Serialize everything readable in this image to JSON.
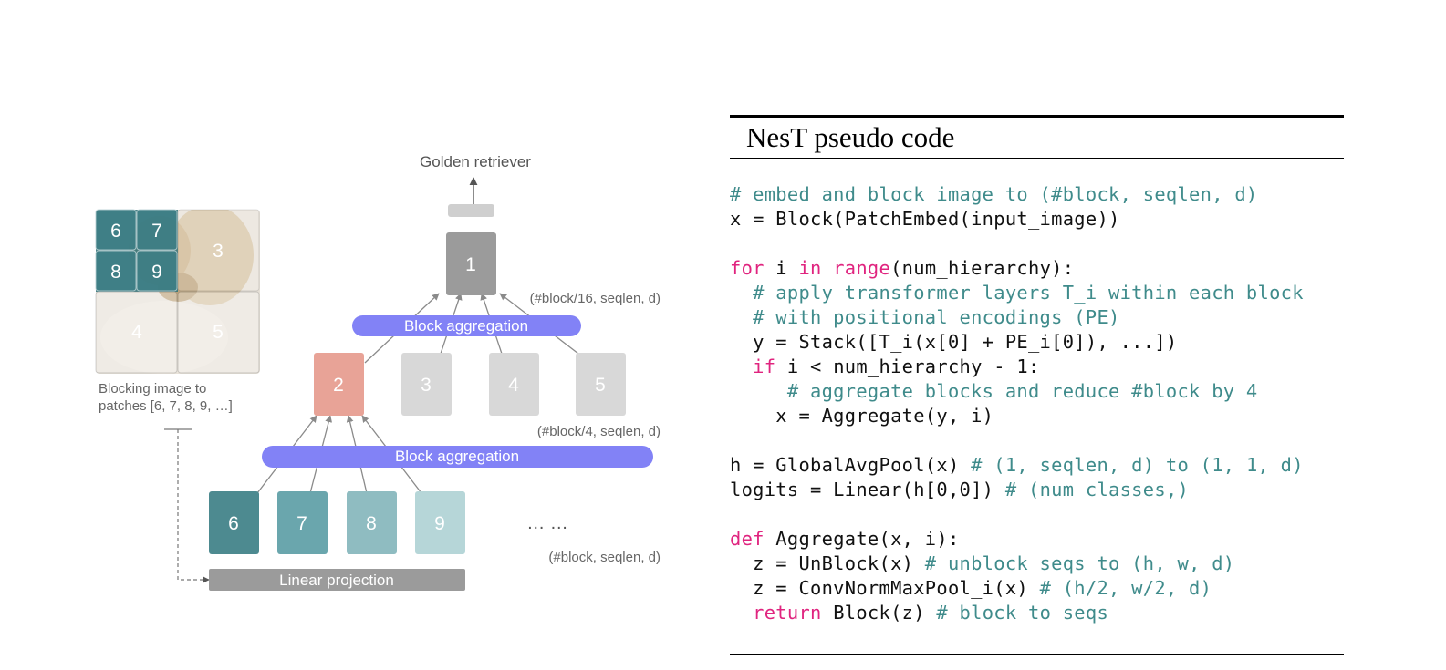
{
  "colors": {
    "teal_dark": "#4d8a90",
    "teal_mid": "#6aa6ad",
    "teal_light": "#8fbcc1",
    "teal_pale": "#b6d6d8",
    "salmon": "#e8a397",
    "gray_dark": "#9b9b9b",
    "gray_light": "#d8d8d8",
    "aggregation_blue": "#8282f6",
    "code_keyword": "#e0247f",
    "code_comment": "#3f8b8b"
  },
  "diagram": {
    "output_label": "Golden retriever",
    "image_patch_numbers": [
      "6",
      "7",
      "8",
      "9",
      "3",
      "4",
      "5"
    ],
    "image_caption": [
      "Blocking image to",
      "patches [6, 7, 8, 9, …]"
    ],
    "top_node": "1",
    "shape_top": "(#block/16, seqlen, d)",
    "aggregation_top": "Block aggregation",
    "mid_nodes": [
      "2",
      "3",
      "4",
      "5"
    ],
    "shape_mid": "(#block/4, seqlen, d)",
    "aggregation_bottom": "Block aggregation",
    "bottom_nodes": [
      "6",
      "7",
      "8",
      "9"
    ],
    "ellipsis": "… …",
    "shape_bottom": "(#block, seqlen, d)",
    "linear_projection": "Linear projection"
  },
  "code": {
    "title": "NesT pseudo code",
    "lines": [
      [
        {
          "t": "# embed and block image to (#block, seqlen, d)",
          "k": "cm"
        }
      ],
      [
        {
          "t": "x = Block(PatchEmbed(input_image))",
          "k": "tx"
        }
      ],
      [],
      [
        {
          "t": "for",
          "k": "kw"
        },
        {
          "t": " i ",
          "k": "tx"
        },
        {
          "t": "in",
          "k": "kw"
        },
        {
          "t": " ",
          "k": "tx"
        },
        {
          "t": "range",
          "k": "kw"
        },
        {
          "t": "(num_hierarchy):",
          "k": "tx"
        }
      ],
      [
        {
          "t": "  # apply transformer layers T_i within each block",
          "k": "cm"
        }
      ],
      [
        {
          "t": "  # with positional encodings (PE)",
          "k": "cm"
        }
      ],
      [
        {
          "t": "  y = Stack([T_i(x[0] + PE_i[0]), ...])",
          "k": "tx"
        }
      ],
      [
        {
          "t": "  ",
          "k": "tx"
        },
        {
          "t": "if",
          "k": "kw"
        },
        {
          "t": " i < num_hierarchy - 1:",
          "k": "tx"
        }
      ],
      [
        {
          "t": "     # aggregate blocks and reduce #block by 4",
          "k": "cm"
        }
      ],
      [
        {
          "t": "    x = Aggregate(y, i)",
          "k": "tx"
        }
      ],
      [],
      [
        {
          "t": "h = GlobalAvgPool(x) ",
          "k": "tx"
        },
        {
          "t": "# (1, seqlen, d) to (1, 1, d)",
          "k": "cm"
        }
      ],
      [
        {
          "t": "logits = Linear(h[0,0]) ",
          "k": "tx"
        },
        {
          "t": "# (num_classes,)",
          "k": "cm"
        }
      ],
      [],
      [
        {
          "t": "def",
          "k": "kw"
        },
        {
          "t": " Aggregate(x, i):",
          "k": "tx"
        }
      ],
      [
        {
          "t": "  z = UnBlock(x) ",
          "k": "tx"
        },
        {
          "t": "# unblock seqs to (h, w, d)",
          "k": "cm"
        }
      ],
      [
        {
          "t": "  z = ConvNormMaxPool_i(x) ",
          "k": "tx"
        },
        {
          "t": "# (h/2, w/2, d)",
          "k": "cm"
        }
      ],
      [
        {
          "t": "  ",
          "k": "tx"
        },
        {
          "t": "return",
          "k": "kw"
        },
        {
          "t": " Block(z) ",
          "k": "tx"
        },
        {
          "t": "# block to seqs",
          "k": "cm"
        }
      ]
    ]
  }
}
